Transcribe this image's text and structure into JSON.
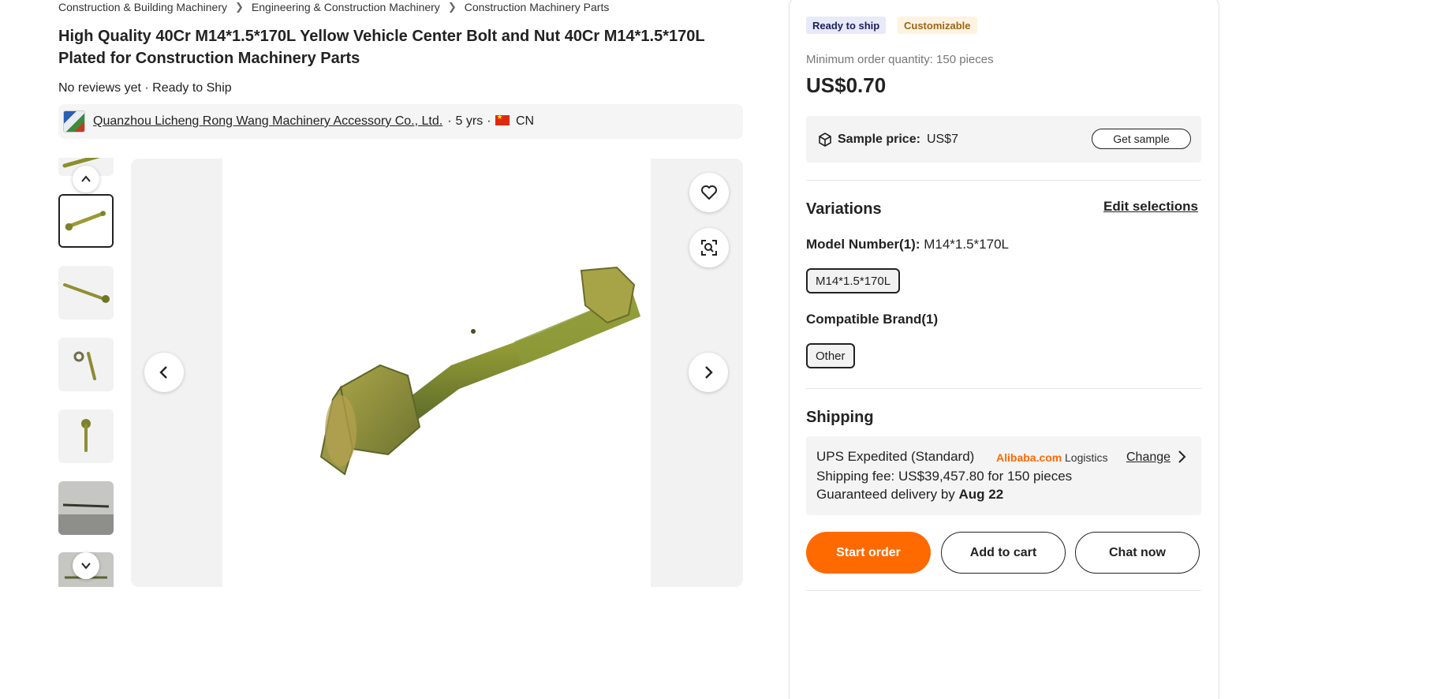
{
  "breadcrumb": [
    "Construction & Building Machinery",
    "Engineering & Construction Machinery",
    "Construction Machinery Parts"
  ],
  "product": {
    "title": "High Quality 40Cr M14*1.5*170L Yellow Vehicle Center Bolt and Nut 40Cr M14*1.5*170L Plated for Construction Machinery Parts",
    "meta": "No reviews yet · Ready to Ship"
  },
  "supplier": {
    "name": "Quanzhou Licheng Rong Wang Machinery Accessory Co., Ltd.",
    "years": "5 yrs",
    "country": "CN"
  },
  "gallery": {
    "icons": {
      "prev": "chevron-left-icon",
      "next": "chevron-right-icon",
      "up": "chevron-up-icon",
      "down": "chevron-down-icon",
      "favorite": "heart-icon",
      "visual_search": "image-search-icon"
    }
  },
  "purchase": {
    "tag_ready": "Ready to ship",
    "tag_custom": "Customizable",
    "moq": "Minimum order quantity: 150 pieces",
    "price": "US$0.70",
    "sample_label": "Sample price:",
    "sample_value": "US$7",
    "get_sample": "Get sample"
  },
  "variations": {
    "heading": "Variations",
    "edit": "Edit selections",
    "model_label": "Model Number(1):",
    "model_value": "M14*1.5*170L",
    "model_chip": "M14*1.5*170L",
    "brand_label": "Compatible Brand(1)",
    "brand_chip": "Other"
  },
  "shipping": {
    "heading": "Shipping",
    "method": "UPS Expedited (Standard)",
    "alibaba": "Alibaba.com",
    "logistics": "Logistics",
    "change": "Change",
    "fee": "Shipping fee: US$39,457.80 for 150 pieces",
    "delivery_prefix": "Guaranteed delivery by",
    "delivery_date": "Aug 22"
  },
  "actions": {
    "start_order": "Start order",
    "add_to_cart": "Add to cart",
    "chat_now": "Chat now"
  },
  "colors": {
    "accent": "#ff6a00",
    "text": "#222222",
    "ready_bg": "#e8e9f9",
    "custom_text": "#9c6616"
  }
}
